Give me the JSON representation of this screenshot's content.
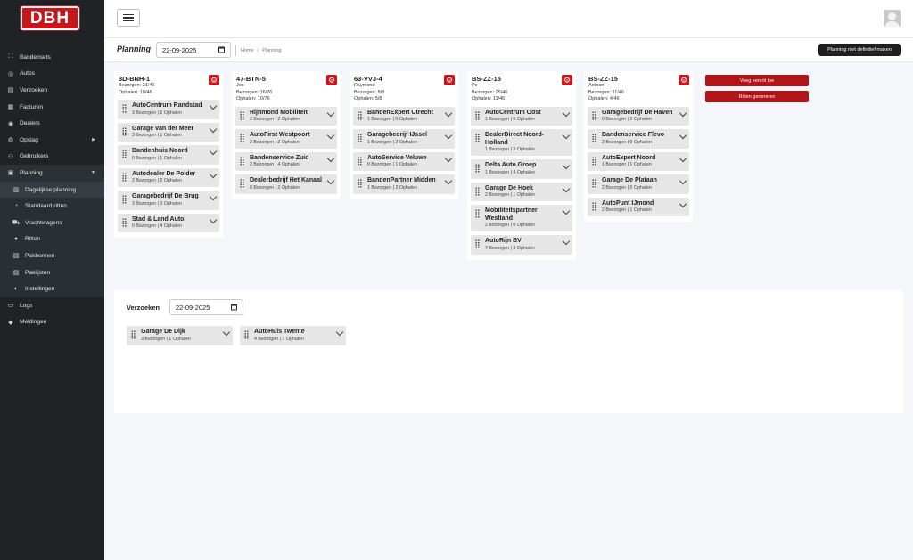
{
  "brand": {
    "logo_text": "DBH",
    "accent": "#c8161d"
  },
  "sidebar": {
    "items": [
      {
        "label": "Bandensets",
        "icon": "expand-icon"
      },
      {
        "label": "Autos",
        "icon": "wheel-icon"
      },
      {
        "label": "Verzoeken",
        "icon": "inbox-icon"
      },
      {
        "label": "Facturen",
        "icon": "invoice-icon"
      },
      {
        "label": "Dealers",
        "icon": "dealer-icon"
      },
      {
        "label": "Opslag",
        "icon": "storage-icon"
      },
      {
        "label": "Gebruikers",
        "icon": "users-icon"
      },
      {
        "label": "Planning",
        "icon": "planning-icon"
      },
      {
        "label": "Dagelijkse planning",
        "icon": "calendar-icon"
      },
      {
        "label": "Standaard ritten",
        "icon": "route-icon"
      },
      {
        "label": "Vrachtwagens",
        "icon": "truck-icon"
      },
      {
        "label": "Ritten",
        "icon": "pin-icon"
      },
      {
        "label": "Pakbonnen",
        "icon": "packing-slip-icon"
      },
      {
        "label": "Paklijsten",
        "icon": "packing-list-icon"
      },
      {
        "label": "Instellingen",
        "icon": "toggle-icon"
      },
      {
        "label": "Logs",
        "icon": "log-icon"
      },
      {
        "label": "Meldingen",
        "icon": "bell-icon"
      }
    ]
  },
  "header": {
    "title": "Planning",
    "date": "22-09-2025",
    "breadcrumb": [
      "Home",
      "Planning"
    ],
    "finalize_label": "Planning niet definitief maken"
  },
  "routes": [
    {
      "plate": "3D-BNH-1",
      "driver": "",
      "deliveries": "Bezorgen: 21/46",
      "pickups": "Ophalen: 10/46",
      "stops": [
        {
          "name": "AutoCentrum Randstad",
          "counts": "3 Bezorgen | 2 Ophalen"
        },
        {
          "name": "Garage van der Meer",
          "counts": "3 Bezorgen | 1 Ophalen"
        },
        {
          "name": "Bandenhuis Noord",
          "counts": "0 Bezorgen | 1 Ophalen"
        },
        {
          "name": "Autodealer De Polder",
          "counts": "2 Bezorgen | 2 Ophalen"
        },
        {
          "name": "Garagebedrijf De Brug",
          "counts": "3 Bezorgen | 0 Ophalen"
        },
        {
          "name": "Stad & Land Auto",
          "counts": "0 Bezorgen | 4 Ophalen"
        }
      ]
    },
    {
      "plate": "47-BTN-5",
      "driver": "Jos",
      "deliveries": "Bezorgen: 16/76",
      "pickups": "Ophalen: 10/76",
      "stops": [
        {
          "name": "Rijnmond Mobiliteit",
          "counts": "2 Bezorgen | 2 Ophalen"
        },
        {
          "name": "AutoFirst Westpoort",
          "counts": "2 Bezorgen | 2 Ophalen"
        },
        {
          "name": "Bandenservice Zuid",
          "counts": "2 Bezorgen | 4 Ophalen"
        },
        {
          "name": "Dealerbedrijf Het Kanaal",
          "counts": "0 Bezorgen | 2 Ophalen"
        }
      ]
    },
    {
      "plate": "63-VVJ-4",
      "driver": "Raymond",
      "deliveries": "Bezorgen: 8/8",
      "pickups": "Ophalen: 5/8",
      "stops": [
        {
          "name": "BandenExpert Utrecht",
          "counts": "1 Bezorgen | 0 Ophalen"
        },
        {
          "name": "Garagebedrijf IJssel",
          "counts": "1 Bezorgen | 2 Ophalen"
        },
        {
          "name": "AutoService Veluwe",
          "counts": "0 Bezorgen | 1 Ophalen"
        },
        {
          "name": "BandenPartner Midden",
          "counts": "1 Bezorgen | 2 Ophalen"
        }
      ]
    },
    {
      "plate": "BS-ZZ-15",
      "driver": "Pe",
      "deliveries": "Bezorgen: 25/46",
      "pickups": "Ophalen: 11/46",
      "stops": [
        {
          "name": "AutoCentrum Oost",
          "counts": "1 Bezorgen | 0 Ophalen"
        },
        {
          "name": "DealerDirect Noord-Holland",
          "counts": "1 Bezorgen | 3 Ophalen"
        },
        {
          "name": "Delta Auto Groep",
          "counts": "1 Bezorgen | 4 Ophalen"
        },
        {
          "name": "Garage De Hoek",
          "counts": "2 Bezorgen | 1 Ophalen"
        },
        {
          "name": "Mobiliteitspartner Westland",
          "counts": "2 Bezorgen | 0 Ophalen"
        },
        {
          "name": "AutoRijn BV",
          "counts": "7 Bezorgen | 3 Ophalen"
        }
      ]
    },
    {
      "plate": "BS-ZZ-15",
      "driver": "Antoon",
      "deliveries": "Bezorgen: 11/46",
      "pickups": "Ophalen: 4/46",
      "stops": [
        {
          "name": "Garagebedrijf De Haven",
          "counts": "0 Bezorgen | 2 Ophalen"
        },
        {
          "name": "Bandenservice Flevo",
          "counts": "2 Bezorgen | 0 Ophalen"
        },
        {
          "name": "AutoExpert Noord",
          "counts": "1 Bezorgen | 1 Ophalen"
        },
        {
          "name": "Garage De Plataan",
          "counts": "2 Bezorgen | 0 Ophalen"
        },
        {
          "name": "AutoPunt IJmond",
          "counts": "2 Bezorgen | 1 Ophalen"
        }
      ]
    }
  ],
  "actions": {
    "add_route_label": "Voeg een rit toe",
    "generate_label": "Ritten genereren"
  },
  "requests": {
    "title": "Verzoeken",
    "date": "22-09-2025",
    "items": [
      {
        "name": "Garage De Dijk",
        "counts": "3 Bezorgen | 1 Ophalen"
      },
      {
        "name": "AutoHuis Twente",
        "counts": "4 Bezorgen | 3 Ophalen"
      }
    ]
  }
}
